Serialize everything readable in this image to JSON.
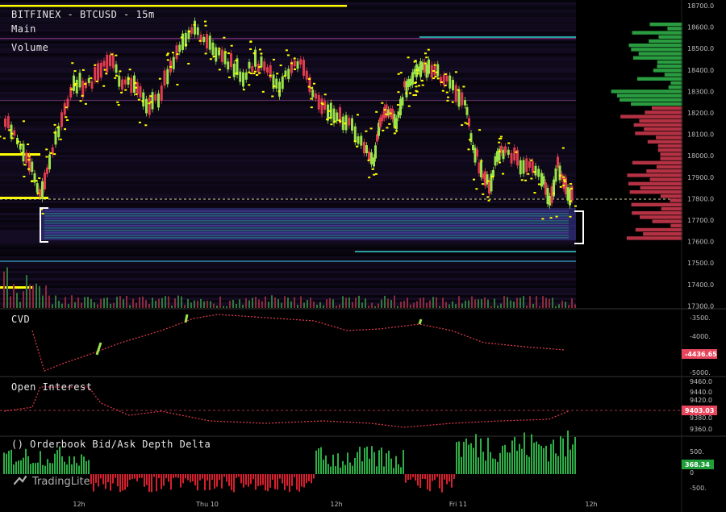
{
  "header": {
    "title": "BITFINEX - BTCUSD - 15m",
    "main": "Main",
    "volume": "Volume"
  },
  "panes": {
    "cvd": {
      "title": "CVD",
      "axis": [
        "-3500.",
        "-4000.",
        "-5000."
      ],
      "badge": "-4436.65",
      "badge_color": "#e8465c"
    },
    "oi": {
      "title": "Open Interest",
      "axis": [
        "9460.0",
        "9440.0",
        "9420.0",
        "9380.0",
        "9360.0"
      ],
      "badge": "9403.03",
      "badge_color": "#e8465c"
    },
    "depth": {
      "title": "() Orderbook Bid/Ask Depth Delta",
      "axis": [
        "500.",
        "0",
        "-500."
      ],
      "badge": "368.34",
      "badge_color": "#1f9e3a"
    }
  },
  "price_axis": [
    "18700.0",
    "18600.0",
    "18500.0",
    "18400.0",
    "18300.0",
    "18200.0",
    "18100.0",
    "18000.0",
    "17900.0",
    "17800.0",
    "17700.0",
    "17600.0",
    "17500.0",
    "17400.0",
    "17300.0"
  ],
  "time_axis": [
    "12h",
    "Thu 10",
    "12h",
    "Fri 11",
    "12h"
  ],
  "brand": {
    "name": "TradingLite"
  },
  "colors": {
    "up": "#9be34a",
    "down": "#e23b4e",
    "bid": "#2fae47",
    "ask": "#c8374a",
    "heat": "#2a1a4a",
    "level": "#ffff00"
  }
}
